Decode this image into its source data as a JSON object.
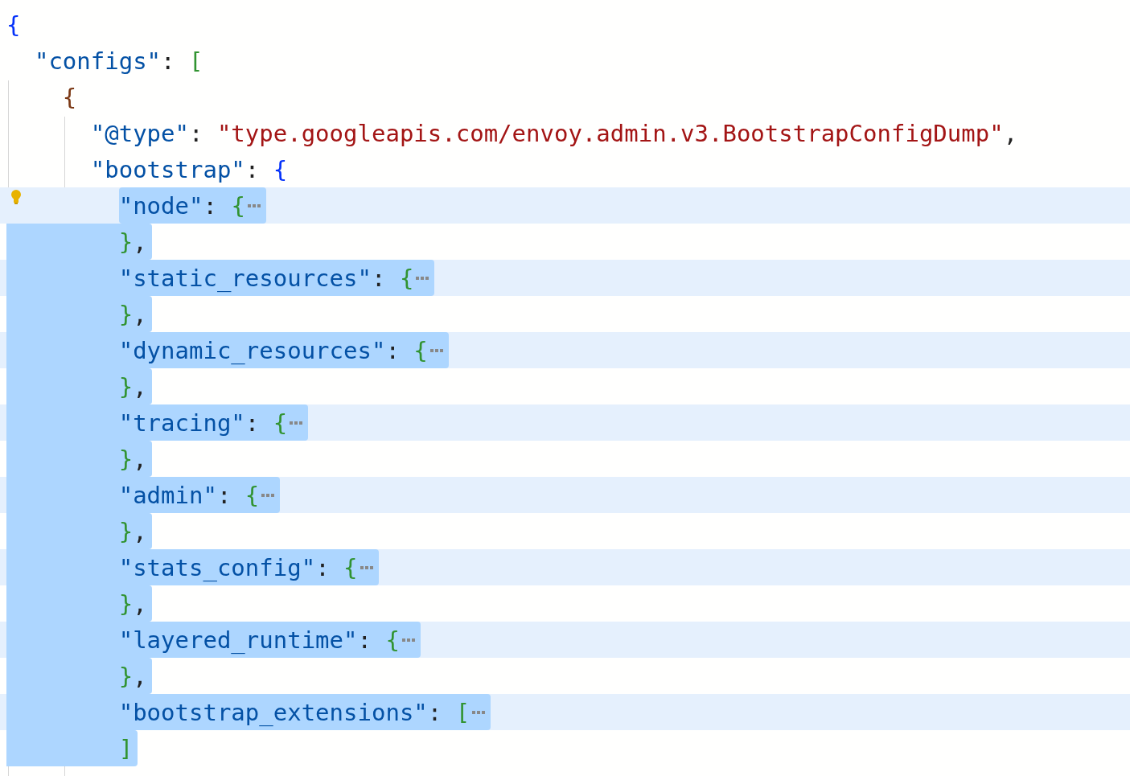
{
  "editor": {
    "lines": [
      {
        "tokens": [
          {
            "kind": "brace0",
            "text": "{"
          }
        ],
        "selected": false,
        "folded": false
      },
      {
        "tokens": [
          {
            "kind": "key",
            "text": "  \"configs\""
          },
          {
            "kind": "punct",
            "text": ": "
          },
          {
            "kind": "brace1",
            "text": "["
          }
        ],
        "selected": false,
        "folded": false
      },
      {
        "tokens": [
          {
            "kind": "brace2",
            "text": "    {"
          }
        ],
        "selected": false,
        "folded": false
      },
      {
        "tokens": [
          {
            "kind": "key",
            "text": "      \"@type\""
          },
          {
            "kind": "punct",
            "text": ": "
          },
          {
            "kind": "string",
            "text": "\"type.googleapis.com/envoy.admin.v3.BootstrapConfigDump\""
          },
          {
            "kind": "punct",
            "text": ","
          }
        ],
        "selected": false,
        "folded": false
      },
      {
        "tokens": [
          {
            "kind": "key",
            "text": "      \"bootstrap\""
          },
          {
            "kind": "punct",
            "text": ": "
          },
          {
            "kind": "brace0",
            "text": "{"
          }
        ],
        "selected": false,
        "folded": false
      },
      {
        "tokens": [
          {
            "kind": "key",
            "text": "        \"node\""
          },
          {
            "kind": "punct",
            "text": ": "
          },
          {
            "kind": "brace1",
            "text": "{"
          }
        ],
        "selected": true,
        "folded": true,
        "lightbulb": true
      },
      {
        "tokens": [
          {
            "kind": "brace1",
            "text": "        }"
          },
          {
            "kind": "punct",
            "text": ","
          }
        ],
        "selected": true,
        "folded": false
      },
      {
        "tokens": [
          {
            "kind": "key",
            "text": "        \"static_resources\""
          },
          {
            "kind": "punct",
            "text": ": "
          },
          {
            "kind": "brace1",
            "text": "{"
          }
        ],
        "selected": true,
        "folded": true
      },
      {
        "tokens": [
          {
            "kind": "brace1",
            "text": "        }"
          },
          {
            "kind": "punct",
            "text": ","
          }
        ],
        "selected": true,
        "folded": false
      },
      {
        "tokens": [
          {
            "kind": "key",
            "text": "        \"dynamic_resources\""
          },
          {
            "kind": "punct",
            "text": ": "
          },
          {
            "kind": "brace1",
            "text": "{"
          }
        ],
        "selected": true,
        "folded": true
      },
      {
        "tokens": [
          {
            "kind": "brace1",
            "text": "        }"
          },
          {
            "kind": "punct",
            "text": ","
          }
        ],
        "selected": true,
        "folded": false
      },
      {
        "tokens": [
          {
            "kind": "key",
            "text": "        \"tracing\""
          },
          {
            "kind": "punct",
            "text": ": "
          },
          {
            "kind": "brace1",
            "text": "{"
          }
        ],
        "selected": true,
        "folded": true
      },
      {
        "tokens": [
          {
            "kind": "brace1",
            "text": "        }"
          },
          {
            "kind": "punct",
            "text": ","
          }
        ],
        "selected": true,
        "folded": false
      },
      {
        "tokens": [
          {
            "kind": "key",
            "text": "        \"admin\""
          },
          {
            "kind": "punct",
            "text": ": "
          },
          {
            "kind": "brace1",
            "text": "{"
          }
        ],
        "selected": true,
        "folded": true
      },
      {
        "tokens": [
          {
            "kind": "brace1",
            "text": "        }"
          },
          {
            "kind": "punct",
            "text": ","
          }
        ],
        "selected": true,
        "folded": false
      },
      {
        "tokens": [
          {
            "kind": "key",
            "text": "        \"stats_config\""
          },
          {
            "kind": "punct",
            "text": ": "
          },
          {
            "kind": "brace1",
            "text": "{"
          }
        ],
        "selected": true,
        "folded": true
      },
      {
        "tokens": [
          {
            "kind": "brace1",
            "text": "        }"
          },
          {
            "kind": "punct",
            "text": ","
          }
        ],
        "selected": true,
        "folded": false
      },
      {
        "tokens": [
          {
            "kind": "key",
            "text": "        \"layered_runtime\""
          },
          {
            "kind": "punct",
            "text": ": "
          },
          {
            "kind": "brace1",
            "text": "{"
          }
        ],
        "selected": true,
        "folded": true
      },
      {
        "tokens": [
          {
            "kind": "brace1",
            "text": "        }"
          },
          {
            "kind": "punct",
            "text": ","
          }
        ],
        "selected": true,
        "folded": false
      },
      {
        "tokens": [
          {
            "kind": "key",
            "text": "        \"bootstrap_extensions\""
          },
          {
            "kind": "punct",
            "text": ": "
          },
          {
            "kind": "brace1",
            "text": "["
          }
        ],
        "selected": true,
        "folded": true
      },
      {
        "tokens": [
          {
            "kind": "brace1",
            "text": "        ]"
          }
        ],
        "selected": true,
        "folded": false
      }
    ]
  }
}
